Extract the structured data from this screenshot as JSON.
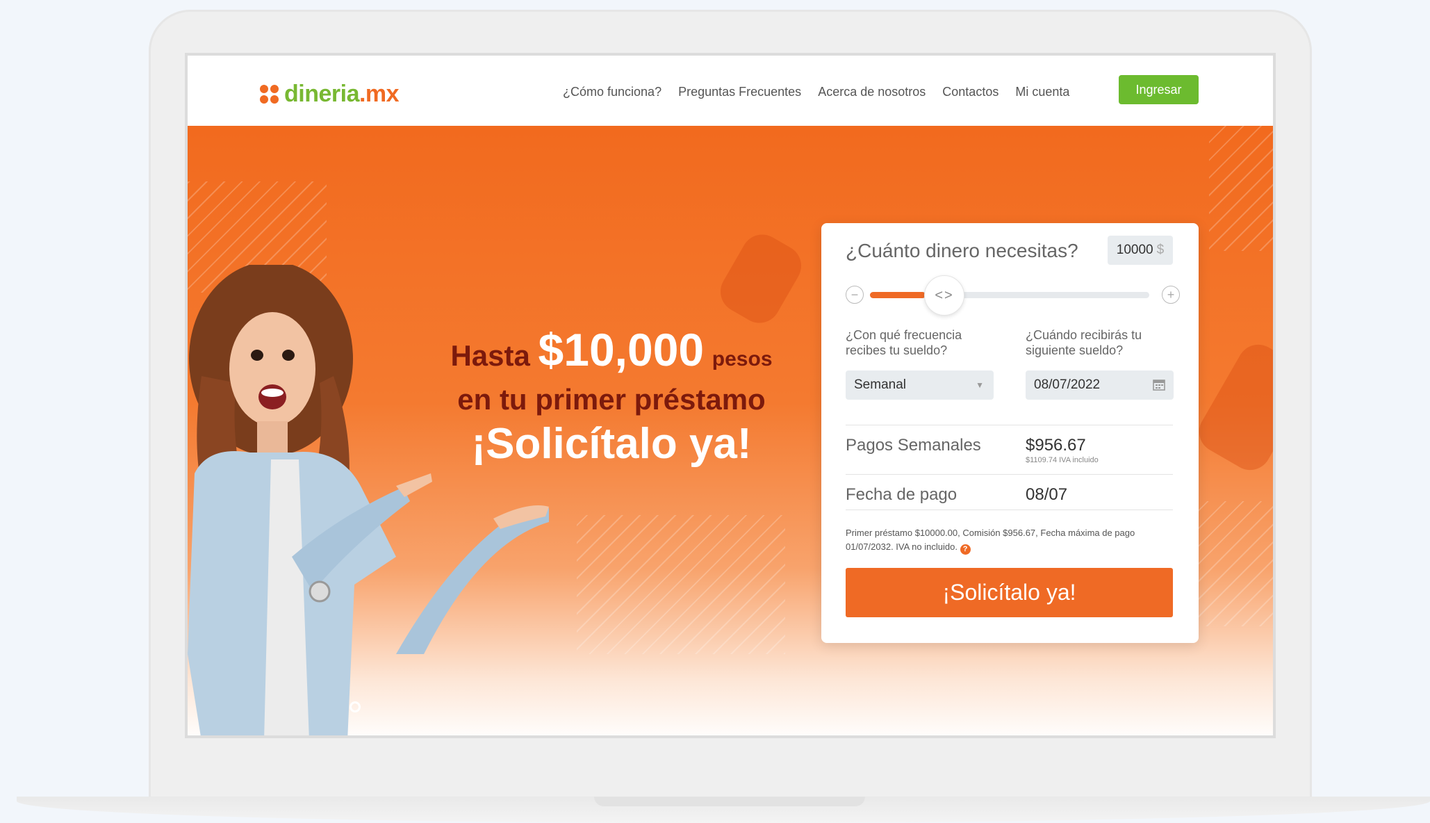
{
  "brand": {
    "name_main": "dineria",
    "name_tld": ".mx",
    "colors": {
      "orange": "#ef6a25",
      "green": "#6cbb2f"
    }
  },
  "nav": {
    "items": [
      {
        "label": "¿Cómo funciona?"
      },
      {
        "label": "Preguntas Frecuentes"
      },
      {
        "label": "Acerca de nosotros"
      },
      {
        "label": "Contactos"
      },
      {
        "label": "Mi cuenta"
      }
    ],
    "login_label": "Ingresar"
  },
  "hero": {
    "line1_prefix": "Hasta",
    "line1_amount": "$10,000",
    "line1_suffix": "pesos",
    "line2": "en tu primer préstamo",
    "line3": "¡Solicítalo ya!"
  },
  "calculator": {
    "question": "¿Cuánto dinero necesitas?",
    "amount_value": "10000",
    "currency_symbol": "$",
    "slider_level_fraction": 0.2,
    "slider_thumb_glyph": "<>",
    "frequency_label": "¿Con qué frecuencia recibes tu sueldo?",
    "frequency_value": "Semanal",
    "next_pay_label": "¿Cuándo recibirás tu siguiente sueldo?",
    "next_pay_value": "08/07/2022",
    "payments_label": "Pagos Semanales",
    "payments_value": "$956.67",
    "payments_sub": "$1109.74 IVA incluido",
    "date_label": "Fecha de pago",
    "date_value": "08/07",
    "disclaimer": "Primer préstamo $10000.00, Comisión $956.67, Fecha máxima de pago 01/07/2032. IVA no incluido.",
    "cta_label": "¡Solicítalo ya!"
  }
}
